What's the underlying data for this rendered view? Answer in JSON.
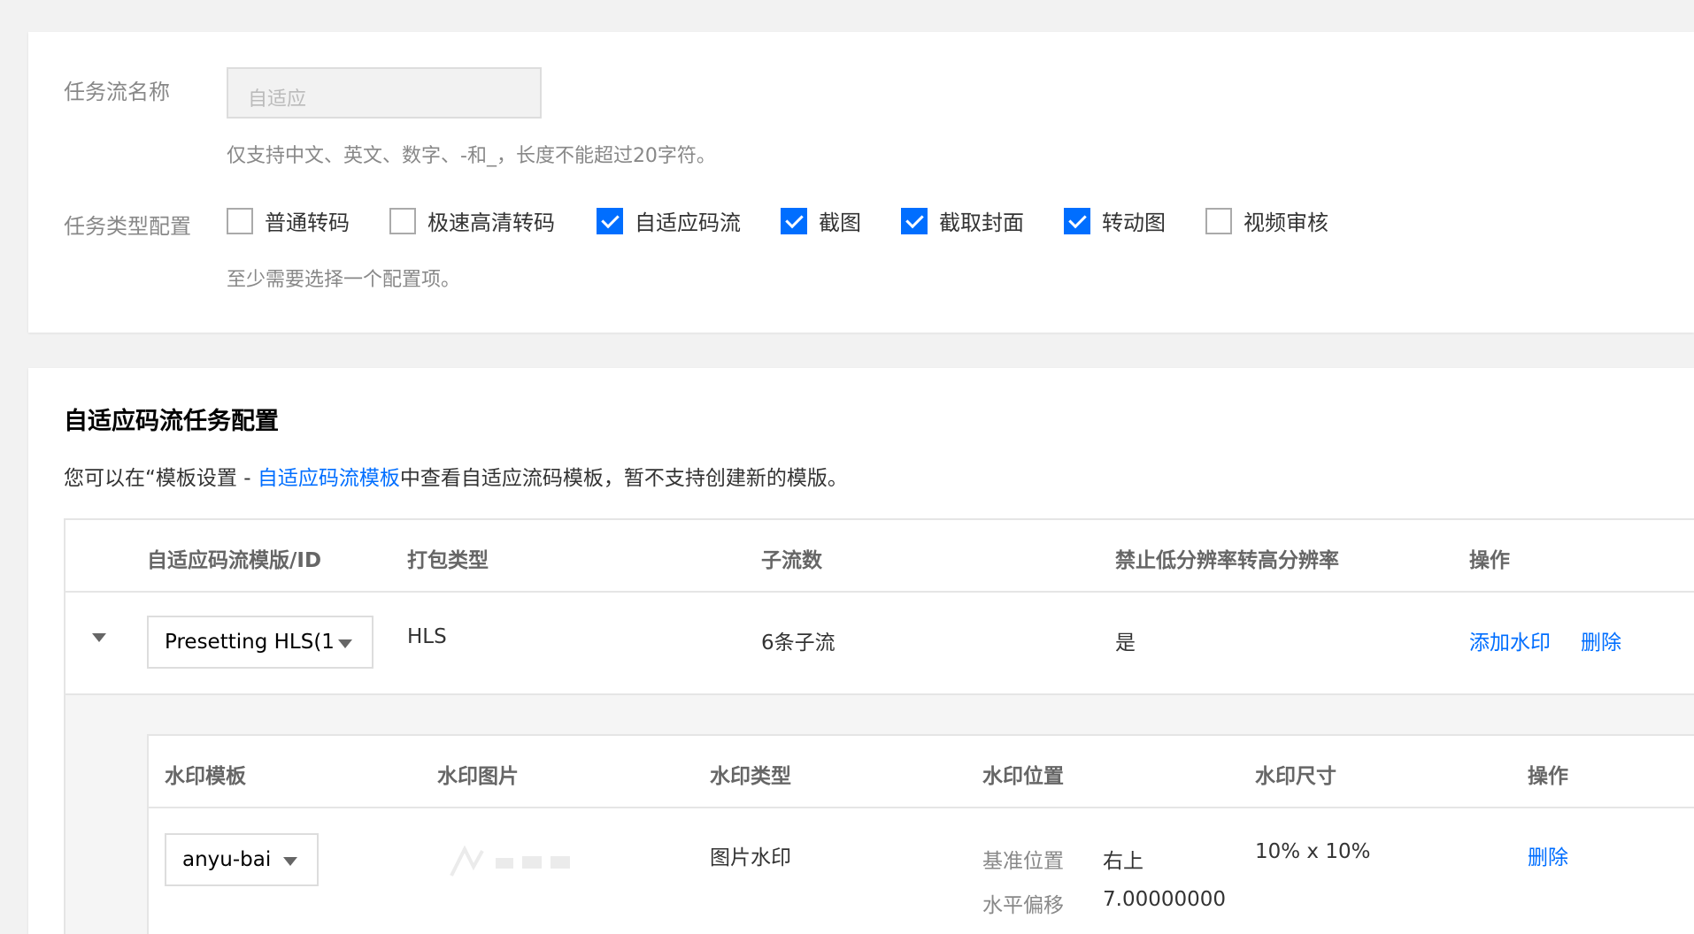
{
  "task_flow": {
    "name_label": "任务流名称",
    "name_value": "自适应",
    "name_hint": "仅支持中文、英文、数字、-和_，长度不能超过20字符。",
    "type_label": "任务类型配置",
    "types": [
      {
        "label": "普通转码",
        "checked": false
      },
      {
        "label": "极速高清转码",
        "checked": false
      },
      {
        "label": "自适应码流",
        "checked": true
      },
      {
        "label": "截图",
        "checked": true
      },
      {
        "label": "截取封面",
        "checked": true
      },
      {
        "label": "转动图",
        "checked": true
      },
      {
        "label": "视频审核",
        "checked": false
      }
    ],
    "type_hint": "至少需要选择一个配置项。"
  },
  "adaptive_section": {
    "title": "自适应码流任务配置",
    "desc_prefix": "您可以在“模板设置 - ",
    "desc_link": "自适应码流模板",
    "desc_suffix": "中查看自适应流码模板，暂不支持创建新的模版。",
    "columns": [
      "自适应码流模版/ID",
      "打包类型",
      "子流数",
      "禁止低分辨率转高分辨率",
      "操作"
    ],
    "row": {
      "template": "Presetting HLS(1",
      "package_type": "HLS",
      "substreams": "6条子流",
      "forbid_upscale": "是",
      "action_add_watermark": "添加水印",
      "action_delete": "删除"
    },
    "watermark": {
      "columns": [
        "水印模板",
        "水印图片",
        "水印类型",
        "水印位置",
        "水印尺寸",
        "操作"
      ],
      "row": {
        "template": "anyu-bai",
        "type": "图片水印",
        "pos_key_1": "基准位置",
        "pos_val_1": "右上",
        "pos_key_2": "水平偏移",
        "pos_val_2": "7.00000000",
        "size": "10% x 10%",
        "action_delete": "删除"
      }
    }
  }
}
